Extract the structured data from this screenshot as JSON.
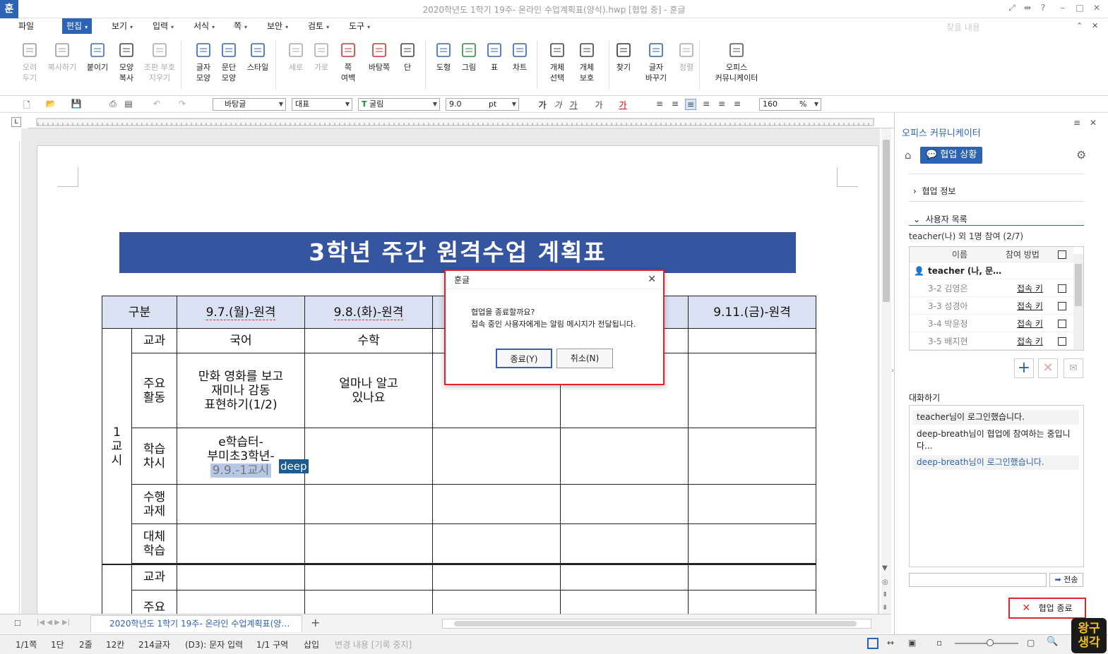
{
  "app": {
    "title": "2020학년도 1학기 19주- 온라인 수업계획표(양식).hwp [협업 중] - 훈글",
    "icon": "훈"
  },
  "menu": {
    "items": [
      "파일",
      "편집",
      "보기",
      "입력",
      "서식",
      "쪽",
      "보안",
      "검토",
      "도구"
    ],
    "active": "편집",
    "search_placeholder": "찾을 내용"
  },
  "ribbon": [
    {
      "l1": "오려",
      "l2": "두기",
      "icon": "scissors-icon",
      "dis": true
    },
    {
      "l1": "복사하기",
      "l2": "",
      "icon": "copy-icon",
      "dis": true
    },
    {
      "l1": "붙이기",
      "l2": "",
      "icon": "paste-icon",
      "dis": false
    },
    {
      "l1": "모양",
      "l2": "복사",
      "icon": "format-painter-icon",
      "dis": false
    },
    {
      "l1": "조판 부호",
      "l2": "지우기",
      "icon": "clear-format-icon",
      "dis": true
    },
    {
      "l1": "글자",
      "l2": "모양",
      "icon": "char-shape-icon",
      "dis": false
    },
    {
      "l1": "문단",
      "l2": "모양",
      "icon": "para-shape-icon",
      "dis": false
    },
    {
      "l1": "스타일",
      "l2": "",
      "icon": "style-icon",
      "dis": false
    },
    {
      "l1": "세로",
      "l2": "",
      "icon": "portrait-icon",
      "dis": true
    },
    {
      "l1": "가로",
      "l2": "",
      "icon": "landscape-icon",
      "dis": true
    },
    {
      "l1": "쪽",
      "l2": "여백",
      "icon": "margin-icon",
      "dis": false
    },
    {
      "l1": "바탕쪽",
      "l2": "",
      "icon": "master-page-icon",
      "dis": false
    },
    {
      "l1": "단",
      "l2": "",
      "icon": "columns-icon",
      "dis": false
    },
    {
      "l1": "도형",
      "l2": "",
      "icon": "shape-icon",
      "dis": false
    },
    {
      "l1": "그림",
      "l2": "",
      "icon": "picture-icon",
      "dis": false
    },
    {
      "l1": "표",
      "l2": "",
      "icon": "table-icon",
      "dis": false
    },
    {
      "l1": "차트",
      "l2": "",
      "icon": "chart-icon",
      "dis": false
    },
    {
      "l1": "개체",
      "l2": "선택",
      "icon": "object-select-icon",
      "dis": false
    },
    {
      "l1": "개체",
      "l2": "보호",
      "icon": "object-protect-icon",
      "dis": false
    },
    {
      "l1": "찾기",
      "l2": "",
      "icon": "binoculars-icon",
      "dis": false
    },
    {
      "l1": "글자",
      "l2": "바꾸기",
      "icon": "replace-icon",
      "dis": false
    },
    {
      "l1": "정렬",
      "l2": "",
      "icon": "sort-icon",
      "dis": true
    },
    {
      "l1": "오피스",
      "l2": "커뮤니케이터",
      "icon": "communicator-icon",
      "dis": false
    }
  ],
  "toolbar2": {
    "style": "바탕글",
    "lang": "대표",
    "font": "굴림",
    "size": "9.0",
    "unit": "pt",
    "zoom": "160",
    "zoom_unit": "%"
  },
  "document": {
    "banner": "3학년 주간 원격수업 계획표",
    "headers": [
      "구분",
      "9.7.(월)-원격",
      "9.8.(화)-원격",
      "9.11.(금)-원격"
    ],
    "period1": "1\n교\n시",
    "rows": [
      {
        "label": "교과",
        "mon": "국어",
        "tue": "수학"
      },
      {
        "label": "주요\n활동",
        "mon": "만화 영화를 보고\n재미나 감동\n표현하기(1/2)",
        "tue": "얼마나 알고\n있나요"
      },
      {
        "label": "학습\n차시",
        "mon": "e학습터-\n부미초3학년-",
        "mon_hl": "9.9.-1교시",
        "tue": ""
      },
      {
        "label": "수행\n과제"
      },
      {
        "label": "대체\n학습"
      },
      {
        "label": "교과"
      },
      {
        "label": "주요"
      }
    ],
    "cursor_tag": "deep"
  },
  "dialog": {
    "title": "훈글",
    "msg1": "협업을 종료할까요?",
    "msg2": "접속 중인 사용자에게는 알림 메시지가 전달됩니다.",
    "ok": "종료(Y)",
    "cancel": "취소(N)"
  },
  "tabs": {
    "doc_tab": "2020학년도 1학기 19주- 온라인 수업계획표(양…"
  },
  "status": [
    "1/1쪽",
    "1단",
    "2줄",
    "12칸",
    "214글자",
    "(D3): 문자 입력",
    "1/1 구역",
    "삽입",
    "변경 내용 [기록 중지]"
  ],
  "side": {
    "title": "오피스 커뮤니케이터",
    "badge": "협업 상황",
    "info": "협업 정보",
    "userlist": "사용자 목록",
    "summary": "teacher(나) 외 1명 참여 (2/7)",
    "col_name": "이름",
    "col_method": "참여 방법",
    "me": "teacher (나, 문…",
    "users": [
      {
        "name": "3-2 김영은",
        "method": "접속 키"
      },
      {
        "name": "3-3 성경아",
        "method": "접속 키"
      },
      {
        "name": "3-4 박윤정",
        "method": "접속 키"
      },
      {
        "name": "3-5 배지현",
        "method": "접속 키"
      }
    ],
    "chat_title": "대화하기",
    "chat": [
      "teacher님이 로그인했습니다.",
      "deep-breath님이 협업에 참여하는 중입니다...",
      "deep-breath님이 로그인했습니다."
    ],
    "send": "전송",
    "end": "협업 종료"
  },
  "logo": {
    "l1": "왕구",
    "l2": "생각"
  }
}
